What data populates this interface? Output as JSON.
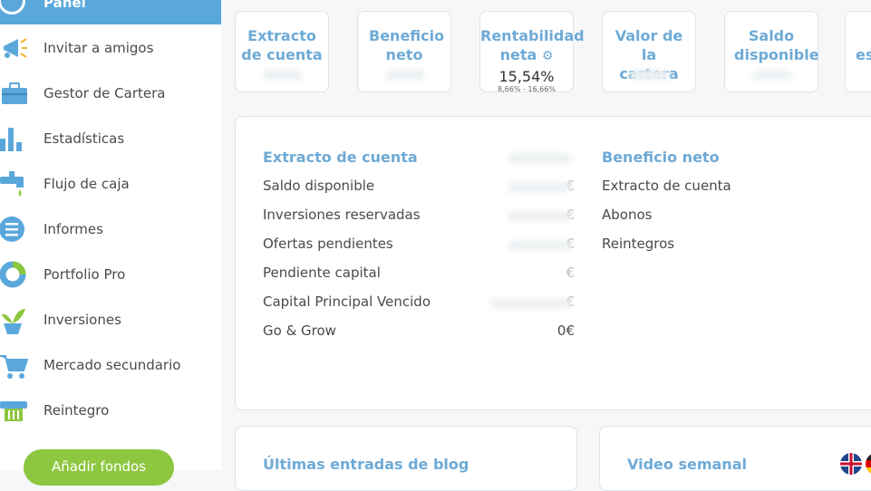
{
  "sidebar": {
    "active": {
      "label": "Panel",
      "icon": "dashboard-gauge-icon"
    },
    "items": [
      {
        "label": "Invitar a amigos",
        "icon": "megaphone-icon",
        "name": "sidebar-item-invitar"
      },
      {
        "label": "Gestor de Cartera",
        "icon": "briefcase-icon",
        "name": "sidebar-item-gestor"
      },
      {
        "label": "Estadísticas",
        "icon": "bar-chart-icon",
        "name": "sidebar-item-estadisticas"
      },
      {
        "label": "Flujo de caja",
        "icon": "faucet-icon",
        "name": "sidebar-item-flujo"
      },
      {
        "label": "Informes",
        "icon": "document-list-icon",
        "name": "sidebar-item-informes"
      },
      {
        "label": "Portfolio Pro",
        "icon": "donut-chart-icon",
        "name": "sidebar-item-portfolio"
      },
      {
        "label": "Inversiones",
        "icon": "plant-icon",
        "name": "sidebar-item-inversiones"
      },
      {
        "label": "Mercado secundario",
        "icon": "cart-icon",
        "name": "sidebar-item-mercado"
      },
      {
        "label": "Reintegro",
        "icon": "withdraw-icon",
        "name": "sidebar-item-reintegro"
      }
    ],
    "add_funds": "Añadir fondos"
  },
  "cards": [
    {
      "title": "Extracto de cuenta"
    },
    {
      "title": "Beneficio neto"
    },
    {
      "title": "Rentabilidad neta",
      "value": "15,54%",
      "range": "8,66% - 16,66%"
    },
    {
      "title": "Valor de la cartera"
    },
    {
      "title": "Saldo disponible"
    },
    {
      "title": "es"
    }
  ],
  "extracto": {
    "title": "Extracto de cuenta",
    "rows": [
      {
        "label": "Saldo disponible",
        "value": "€"
      },
      {
        "label": "Inversiones reservadas",
        "value": "€"
      },
      {
        "label": "Ofertas pendientes",
        "value": "€"
      },
      {
        "label": "Pendiente capital",
        "value": "€"
      },
      {
        "label": "Capital Principal Vencido",
        "value": "€"
      },
      {
        "label": "Go & Grow",
        "value": "0€"
      }
    ]
  },
  "beneficio": {
    "title": "Beneficio neto",
    "rows": [
      {
        "label": "Extracto de cuenta"
      },
      {
        "label": "Abonos"
      },
      {
        "label": "Reintegros"
      }
    ]
  },
  "blog": {
    "title": "Últimas entradas de blog"
  },
  "video": {
    "title": "Video semanal"
  },
  "colors": {
    "accent": "#5aa7dc",
    "title": "#6eaad6",
    "green": "#8dc63f"
  }
}
